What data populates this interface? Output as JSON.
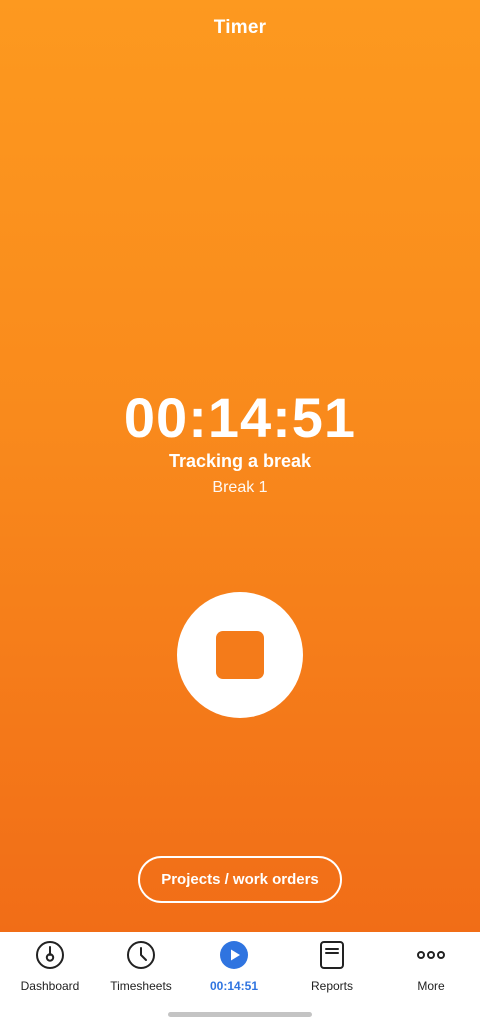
{
  "header": {
    "title": "Timer"
  },
  "timer": {
    "elapsed": "00:14:51",
    "status": "Tracking a break",
    "substatus": "Break 1"
  },
  "actions": {
    "stop_icon": "stop-icon",
    "projects_label": "Projects / work orders"
  },
  "nav": {
    "items": [
      {
        "label": "Dashboard",
        "icon": "dashboard-gauge-icon"
      },
      {
        "label": "Timesheets",
        "icon": "clock-icon"
      },
      {
        "label": "00:14:51",
        "icon": "play-icon",
        "active": true
      },
      {
        "label": "Reports",
        "icon": "report-document-icon"
      },
      {
        "label": "More",
        "icon": "more-dots-icon"
      }
    ]
  },
  "colors": {
    "gradient_top": "#FD991F",
    "gradient_bottom": "#F16D17",
    "stop_square": "#F47B1A",
    "active_nav": "#2F74E0"
  }
}
